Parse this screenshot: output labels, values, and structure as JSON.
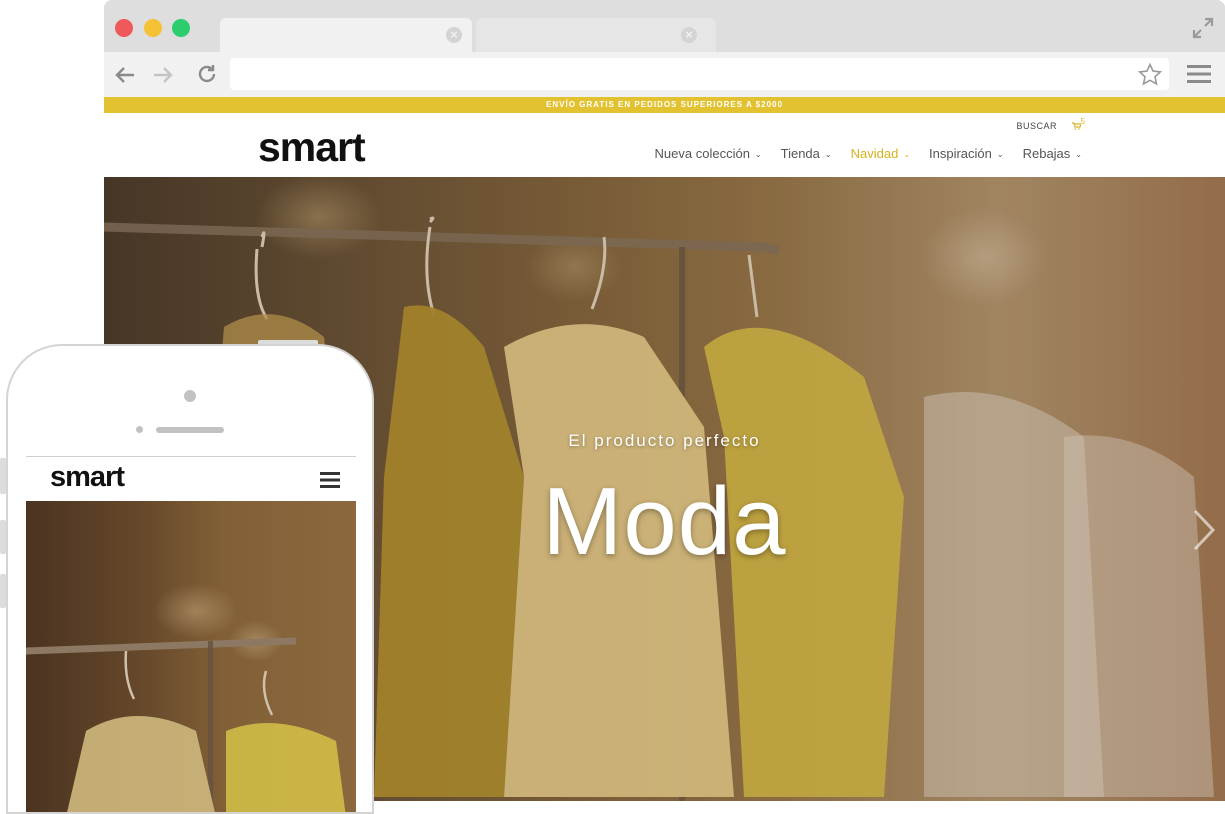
{
  "browser": {
    "window_controls": [
      "close",
      "minimize",
      "maximize"
    ],
    "tabs": [
      {
        "close_label": "×"
      },
      {
        "close_label": "×"
      }
    ],
    "address": {
      "value": ""
    },
    "icons": [
      "back-arrow-icon",
      "forward-arrow-icon",
      "reload-icon",
      "star-icon",
      "menu-icon",
      "expand-icon"
    ]
  },
  "site": {
    "promo": "ENVÍO GRATIS EN PEDIDOS SUPERIORES A $2000",
    "logo": "smart",
    "search": "BUSCAR",
    "cart_count": "5",
    "nav": [
      {
        "label": "Nueva colección"
      },
      {
        "label": "Tienda"
      },
      {
        "label": "Navidad"
      },
      {
        "label": "Inspiración"
      },
      {
        "label": "Rebajas"
      }
    ],
    "active_nav": "Navidad",
    "hero": {
      "subtitle": "El producto perfecto",
      "title": "Moda"
    },
    "accent_color": "#e3c232"
  },
  "mobile": {
    "logo": "smart"
  }
}
